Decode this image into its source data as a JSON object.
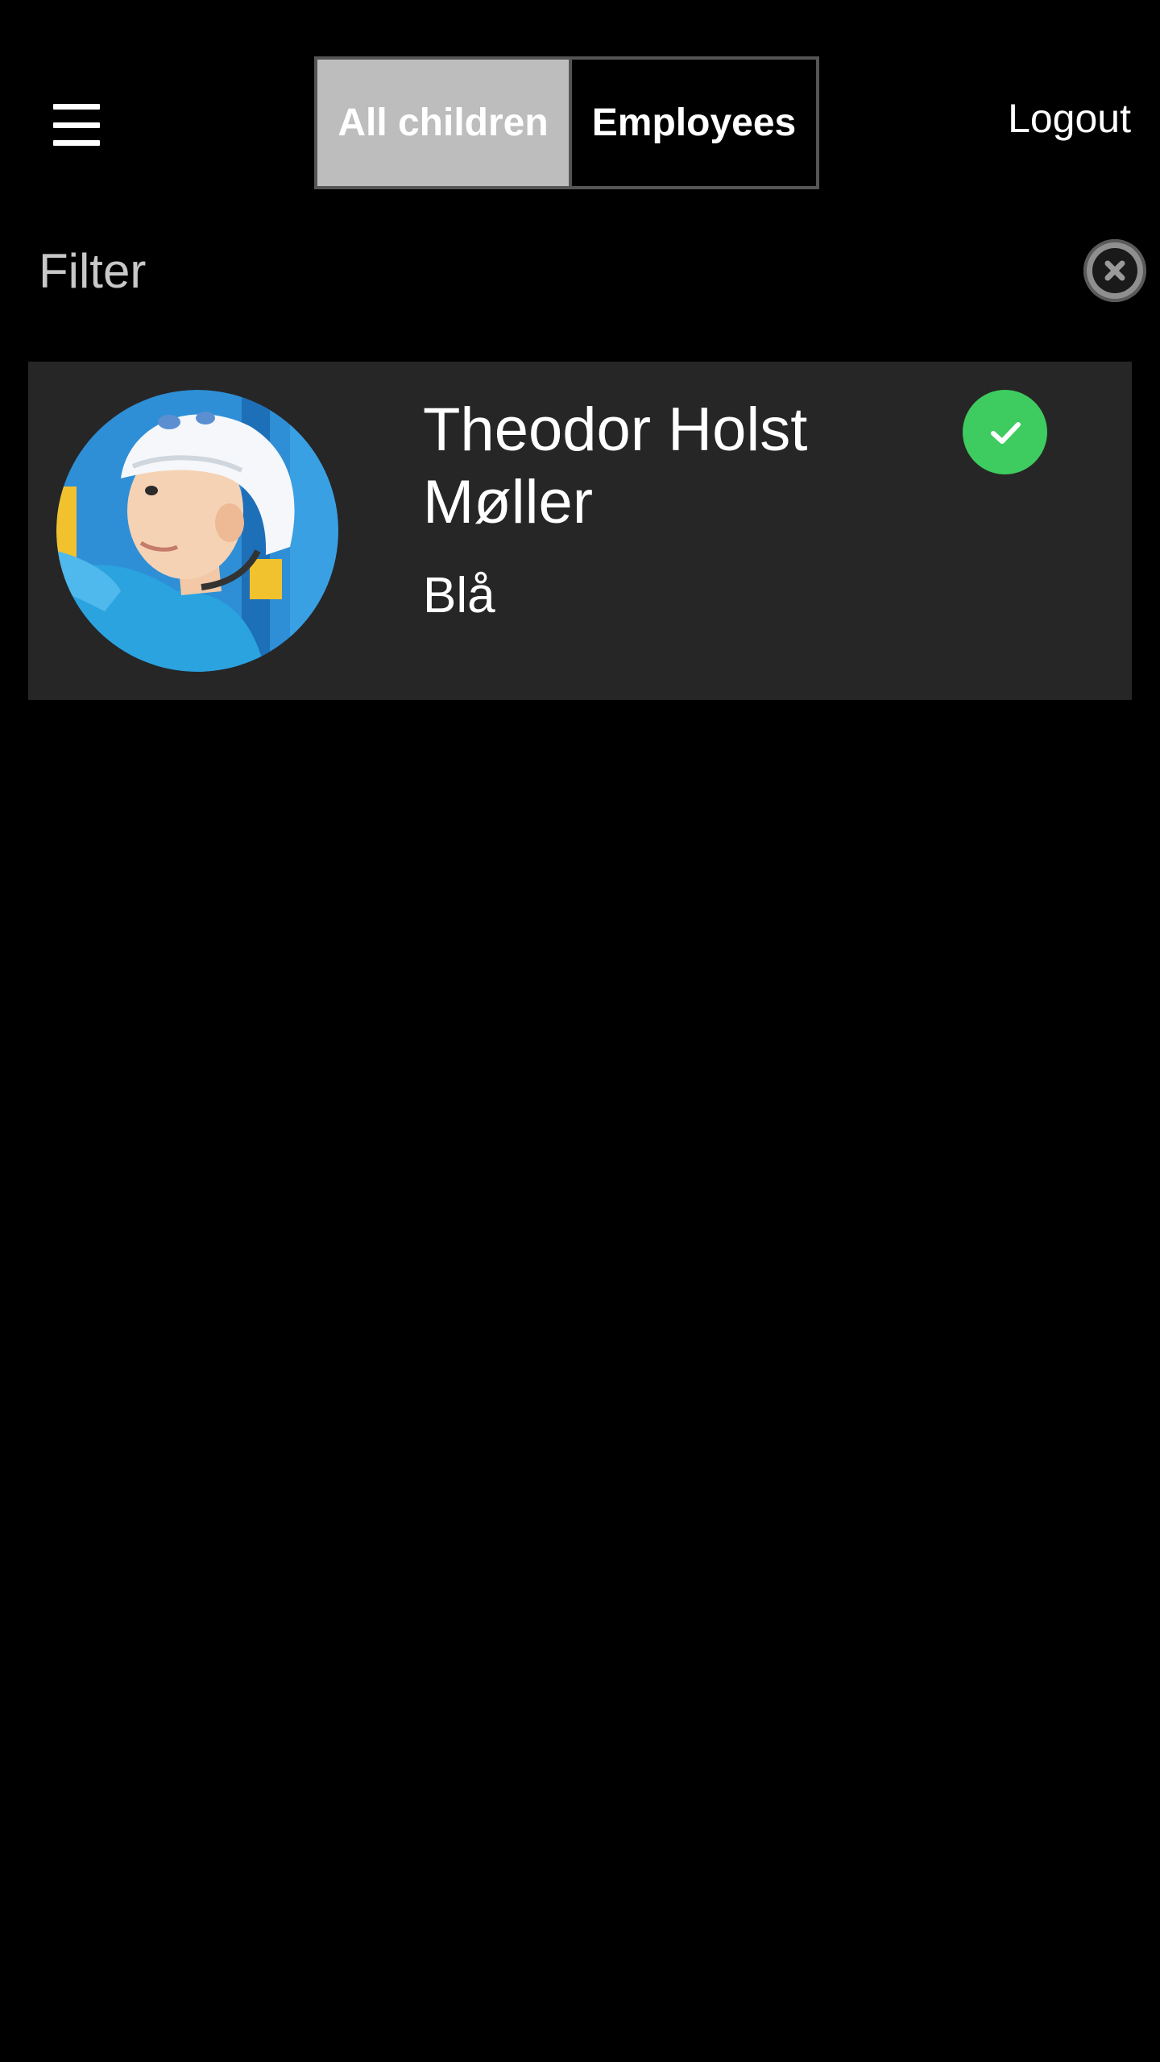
{
  "header": {
    "menu_icon": "hamburger-menu-icon",
    "tabs": [
      {
        "label": "All children",
        "active": true
      },
      {
        "label": "Employees",
        "active": false
      }
    ],
    "logout_label": "Logout"
  },
  "filter": {
    "placeholder": "Filter",
    "value": "",
    "clear_icon": "clear-circle-x-icon"
  },
  "children": [
    {
      "name": "Theodor Holst Møller",
      "group": "Blå",
      "status_icon": "check-circle-icon",
      "status_color": "#3ecb5f"
    }
  ],
  "colors": {
    "background": "#000000",
    "card": "#262626",
    "active_tab": "#bdbdbd",
    "tab_border": "#555555",
    "checked_in": "#3ecb5f"
  }
}
